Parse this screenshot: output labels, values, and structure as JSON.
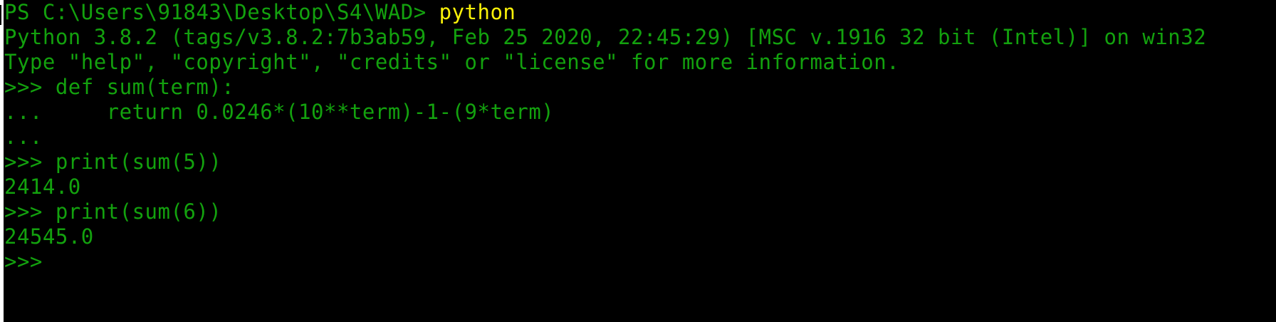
{
  "terminal": {
    "lines": [
      {
        "prompt": "PS C:\\Users\\91843\\Desktop\\S4\\WAD> ",
        "command": "python"
      },
      {
        "text": "Python 3.8.2 (tags/v3.8.2:7b3ab59, Feb 25 2020, 22:45:29) [MSC v.1916 32 bit (Intel)] on win32"
      },
      {
        "text": "Type \"help\", \"copyright\", \"credits\" or \"license\" for more information."
      },
      {
        "text": ">>> def sum(term):"
      },
      {
        "text": "...     return 0.0246*(10**term)-1-(9*term)"
      },
      {
        "text": "..."
      },
      {
        "text": ">>> print(sum(5))"
      },
      {
        "text": "2414.0"
      },
      {
        "text": ">>> print(sum(6))"
      },
      {
        "text": "24545.0"
      },
      {
        "text": ">>>"
      }
    ],
    "colors": {
      "background": "#000000",
      "output": "#13a10e",
      "command": "#f9f109"
    }
  }
}
